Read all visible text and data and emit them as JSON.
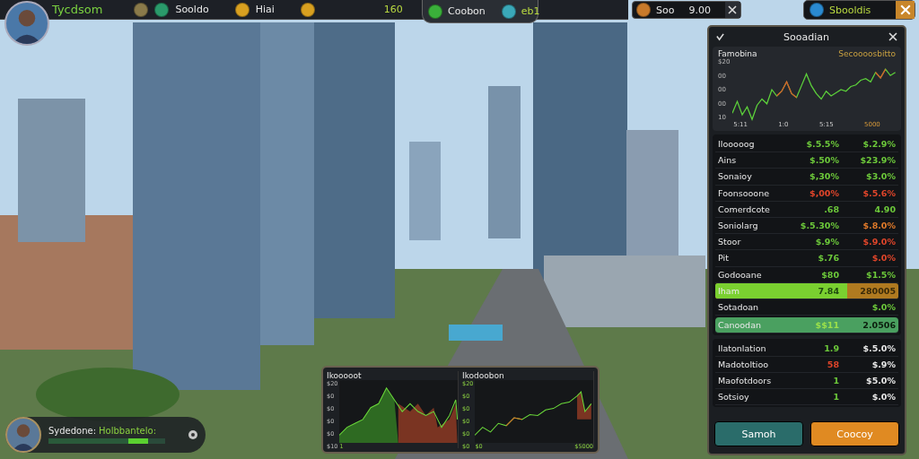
{
  "top_bar": {
    "title": "Tycdsom",
    "items": [
      {
        "color": "#8a7a4a"
      },
      {
        "color": "#2a9a6a",
        "label": "Sooldo"
      },
      {
        "color": "#d8a020",
        "label": "Hiai"
      },
      {
        "color": "#d8a020"
      }
    ],
    "reading": "160",
    "tab_items": [
      {
        "color": "#3ab03a",
        "label": "Coobon"
      },
      {
        "color": "#3aa8b8",
        "label": "eb1"
      }
    ]
  },
  "coin_box": {
    "label": "Soo",
    "value": "9.00"
  },
  "gem_box": {
    "label": "Sbooldis"
  },
  "market_panel": {
    "title": "Sooadian",
    "chart": {
      "title": "Famobina",
      "legend": "Secoooosbitto",
      "y_labels": [
        "$20",
        "00",
        "00",
        "00",
        "10"
      ],
      "x_labels": [
        "5:11",
        "1:0",
        "5:15",
        "5000"
      ]
    },
    "rows": [
      {
        "kind": "row",
        "name": "Ilooooog",
        "v1": {
          "text": "$.5.5%",
          "color": "#6cc83a"
        },
        "v2": {
          "text": "$.2.9%",
          "color": "#6cc83a"
        }
      },
      {
        "kind": "row",
        "name": "Ains",
        "v1": {
          "text": "$.50%",
          "color": "#6cc83a"
        },
        "v2": {
          "text": "$23.9%",
          "color": "#6cc83a"
        }
      },
      {
        "kind": "row",
        "name": "Sonaioy",
        "v1": {
          "text": "$,30%",
          "color": "#6cc83a"
        },
        "v2": {
          "text": "$3.0%",
          "color": "#6cc83a"
        }
      },
      {
        "kind": "row",
        "name": "Foonsooone",
        "v1": {
          "text": "$,00%",
          "color": "#e0452a"
        },
        "v2": {
          "text": "$.5.6%",
          "color": "#e0452a"
        }
      },
      {
        "kind": "row",
        "name": "Comerdcote",
        "v1": {
          "text": ".68",
          "color": "#6cc83a"
        },
        "v2": {
          "text": "4.90",
          "color": "#6cc83a"
        }
      },
      {
        "kind": "row",
        "name": "Soniolarg",
        "v1": {
          "text": "$.5.30%",
          "color": "#6cc83a"
        },
        "v2": {
          "text": "$.8.0%",
          "color": "#e07a2a"
        }
      },
      {
        "kind": "row",
        "name": "Stoor",
        "v1": {
          "text": "$.9%",
          "color": "#6cc83a"
        },
        "v2": {
          "text": "$.9.0%",
          "color": "#e0452a"
        }
      },
      {
        "kind": "row",
        "name": "Pit",
        "v1": {
          "text": "$.76",
          "color": "#6cc83a"
        },
        "v2": {
          "text": "$.0%",
          "color": "#e0452a"
        }
      },
      {
        "kind": "row",
        "name": "Godooane",
        "v1": {
          "text": "$80",
          "color": "#6cc83a"
        },
        "v2": {
          "text": "$1.5%",
          "color": "#6cc83a"
        }
      },
      {
        "kind": "progress",
        "name": "Iham",
        "v1": {
          "text": "7.84",
          "color": "#1f4a10"
        },
        "v2": {
          "text": "280005",
          "color": "#3a2a08"
        },
        "level": 0.72
      },
      {
        "kind": "row",
        "name": "Sotadoan",
        "v2": {
          "text": "$.0%",
          "color": "#6cc83a"
        }
      },
      {
        "kind": "band",
        "name": "Canoodan",
        "v1": {
          "text": "$$11",
          "color": "#9be04a"
        },
        "v2": {
          "text": "2.0506",
          "color": "#0c1e0e"
        }
      }
    ],
    "summary": [
      {
        "name": "Ilatonlation",
        "v1": {
          "text": "1.9",
          "color": "#6cc83a"
        },
        "v2": {
          "text": "$.5.0%",
          "color": "#e8e8e8"
        }
      },
      {
        "name": "Madotoltioo",
        "v1": {
          "text": "58",
          "color": "#e0452a"
        },
        "v2": {
          "text": "$.9%",
          "color": "#e8e8e8"
        }
      },
      {
        "name": "Maofotdoors",
        "v1": {
          "text": "1",
          "color": "#6cc83a"
        },
        "v2": {
          "text": "$5.0%",
          "color": "#e8e8e8"
        }
      },
      {
        "name": "Sotsioy",
        "v1": {
          "text": "1",
          "color": "#6cc83a"
        },
        "v2": {
          "text": "$.0%",
          "color": "#e8e8e8"
        }
      }
    ],
    "buttons": [
      {
        "label": "Samoh",
        "kind": "teal"
      },
      {
        "label": "Coocoy",
        "kind": "orange"
      }
    ]
  },
  "bottom_charts": [
    {
      "title": "Ikooooot",
      "y_labels": [
        "$20",
        "$0",
        "$0",
        "$0",
        "$0",
        "$10"
      ],
      "x_labels": [
        "1"
      ]
    },
    {
      "title": "Ikodoobon",
      "y_labels": [
        "$20",
        "$0",
        "$0",
        "$0",
        "$0",
        "$0"
      ],
      "x_labels": [
        "$0",
        "$5000"
      ]
    }
  ],
  "player": {
    "label": "Sydedone:",
    "name": "Holbbantelo:",
    "level": 0.85
  }
}
